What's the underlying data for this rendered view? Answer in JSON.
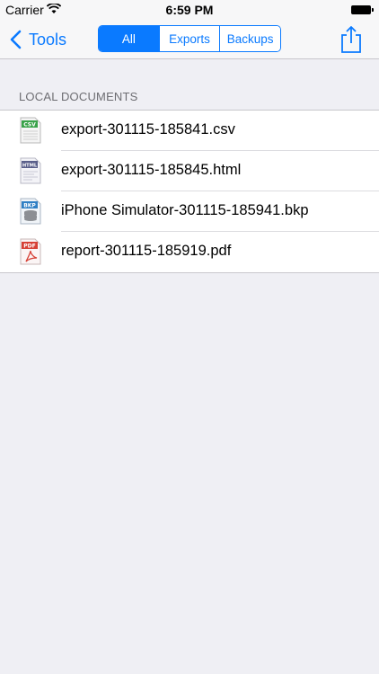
{
  "status_bar": {
    "carrier": "Carrier",
    "time": "6:59 PM"
  },
  "nav": {
    "back_label": "Tools",
    "segments": [
      "All",
      "Exports",
      "Backups"
    ],
    "active_segment": "All"
  },
  "section": {
    "header": "LOCAL DOCUMENTS"
  },
  "files": [
    {
      "name": "export-301115-185841.csv",
      "type": "CSV",
      "icon": "csv-file-icon",
      "color": "#3aa34a"
    },
    {
      "name": "export-301115-185845.html",
      "type": "HTML",
      "icon": "html-file-icon",
      "color": "#5a5f8a"
    },
    {
      "name": "iPhone Simulator-301115-185941.bkp",
      "type": "BKP",
      "icon": "bkp-file-icon",
      "color": "#2f7fc4"
    },
    {
      "name": "report-301115-185919.pdf",
      "type": "PDF",
      "icon": "pdf-file-icon",
      "color": "#d64035"
    }
  ],
  "colors": {
    "accent": "#0a7aff",
    "background": "#efeff4"
  }
}
